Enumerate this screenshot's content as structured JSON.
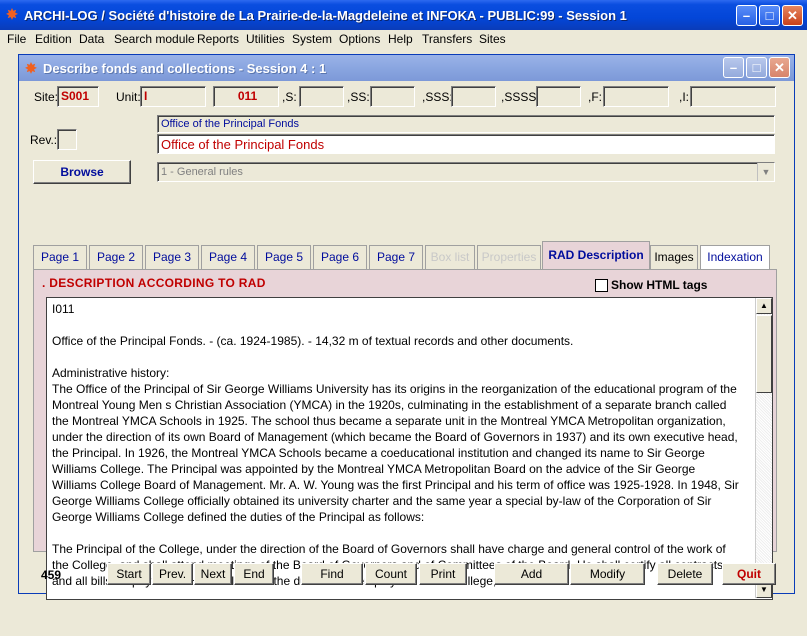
{
  "app": {
    "title": "ARCHI-LOG / Société d'histoire de La Prairie-de-la-Magdeleine et INFOKA - PUBLIC:99 - Session 1"
  },
  "menu": [
    "File",
    "Edition",
    "Data",
    "Search module",
    "Reports",
    "Utilities",
    "System",
    "Options",
    "Help",
    "Transfers",
    "Sites"
  ],
  "window": {
    "title": "Describe fonds and collections - Session 4 : 1"
  },
  "codes": {
    "site_label": "Site:",
    "site_value": "S001",
    "unit_label": "Unit:",
    "unit_value": "I",
    "unit_number": "011",
    "s_label": ",S:",
    "ss_label": ",SS:",
    "sss_label": ",SSS:",
    "ssss_label": ",SSSS:",
    "f_label": ",F:",
    "i_label": ",I:"
  },
  "rev": {
    "label": "Rev.:"
  },
  "header": {
    "subtitle": "Office of the Principal Fonds",
    "title": "Office of the Principal Fonds"
  },
  "browse_label": "Browse",
  "rules_select": {
    "value": "1 - General rules"
  },
  "tabs": [
    {
      "label": "Page 1",
      "state": "normal"
    },
    {
      "label": "Page 2",
      "state": "normal"
    },
    {
      "label": "Page 3",
      "state": "normal"
    },
    {
      "label": "Page 4",
      "state": "normal"
    },
    {
      "label": "Page 5",
      "state": "normal"
    },
    {
      "label": "Page 6",
      "state": "normal"
    },
    {
      "label": "Page 7",
      "state": "normal"
    },
    {
      "label": "Box list",
      "state": "disabled"
    },
    {
      "label": "Properties",
      "state": "disabled"
    },
    {
      "label": "RAD Description",
      "state": "active"
    },
    {
      "label": "Images",
      "state": "normal"
    },
    {
      "label": "Indexation",
      "state": "normal"
    }
  ],
  "panel": {
    "section_title": ".  DESCRIPTION ACCORDING TO RAD",
    "show_html_label": "Show HTML tags",
    "description": {
      "line1": "I011",
      "line2": "Office of the Principal Fonds. - (ca. 1924-1985). - 14,32 m of textual records and other documents.",
      "admin_heading": "Administrative history:",
      "admin_text": "The Office of the Principal of Sir George Williams University has its origins in the reorganization of the educational program of the Montreal Young Men s Christian Association (YMCA) in the 1920s, culminating in the establishment of a separate branch called the Montreal YMCA Schools in 1925.  The school thus became a separate unit in the Montreal YMCA Metropolitan organization, under the direction of its own Board of Management (which became the Board of Governors in 1937) and its own executive head, the Principal.  In 1926, the Montreal YMCA Schools became a coeducational institution and changed its name to Sir George Williams College.  The Principal was appointed by the Montreal YMCA Metropolitan Board on the advice of the Sir George Williams College Board of Management.  Mr. A. W. Young was the first Principal and his term of office was 1925-1928.  In 1948, Sir George Williams College officially obtained its university charter and the same year a special by-law of the Corporation of Sir George Williams College defined the duties of the Principal as follows:",
      "duties_text": "The Principal of the College, under the direction of the Board of Governors shall have charge and general control of the work of the College, and shall attend meetings of the Board of Governors and of Committees of the Board.  He shall certify all contracts and all bills for payments.  He shall define the duties of all employees of the College, who shall"
    }
  },
  "footer": {
    "record_count": "459",
    "buttons": {
      "start": "Start",
      "prev": "Prev.",
      "next": "Next",
      "end": "End",
      "find": "Find",
      "count": "Count",
      "print": "Print",
      "add": "Add",
      "modify": "Modify",
      "delete": "Delete",
      "quit": "Quit"
    }
  }
}
